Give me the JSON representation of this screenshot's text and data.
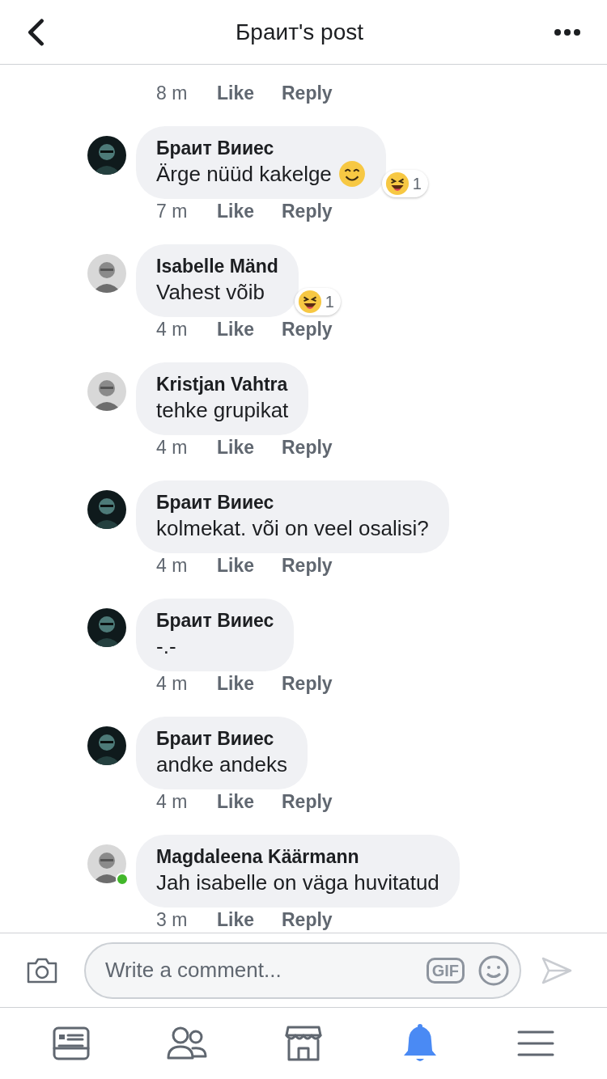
{
  "header": {
    "title": "Браит's post"
  },
  "top_actions": {
    "time": "8 m",
    "like": "Like",
    "reply": "Reply"
  },
  "comments": [
    {
      "author": "Браит Вииес",
      "text": "Ärge nüüd kakelge",
      "smiley": true,
      "online": false,
      "avatar_dark": true,
      "time": "7 m",
      "like": "Like",
      "reply": "Reply",
      "reaction": {
        "count": "1"
      }
    },
    {
      "author": "Isabelle Mänd",
      "text": "Vahest võib",
      "smiley": false,
      "online": false,
      "avatar_dark": false,
      "time": "4 m",
      "like": "Like",
      "reply": "Reply",
      "reaction": {
        "count": "1"
      }
    },
    {
      "author": "Kristjan Vahtra",
      "text": "tehke grupikat",
      "smiley": false,
      "online": false,
      "avatar_dark": false,
      "time": "4 m",
      "like": "Like",
      "reply": "Reply"
    },
    {
      "author": "Браит Вииес",
      "text": "kolmekat. või on veel osalisi?",
      "smiley": false,
      "online": false,
      "avatar_dark": true,
      "time": "4 m",
      "like": "Like",
      "reply": "Reply"
    },
    {
      "author": "Браит Вииес",
      "text": "-.-",
      "smiley": false,
      "online": false,
      "avatar_dark": true,
      "time": "4 m",
      "like": "Like",
      "reply": "Reply"
    },
    {
      "author": "Браит Вииес",
      "text": "andke andeks",
      "smiley": false,
      "online": false,
      "avatar_dark": true,
      "time": "4 m",
      "like": "Like",
      "reply": "Reply"
    },
    {
      "author": "Magdaleena Käärmann",
      "text": "Jah isabelle on väga huvitatud",
      "smiley": false,
      "online": true,
      "avatar_dark": false,
      "time": "3 m",
      "like": "Like",
      "reply": "Reply"
    }
  ],
  "composer": {
    "placeholder": "Write a comment...",
    "gif": "GIF"
  },
  "nav": [
    {
      "kind": "feed",
      "selected": false
    },
    {
      "kind": "friends",
      "selected": false
    },
    {
      "kind": "marketplace",
      "selected": false
    },
    {
      "kind": "notifications",
      "selected": true
    },
    {
      "kind": "menu",
      "selected": false
    }
  ]
}
